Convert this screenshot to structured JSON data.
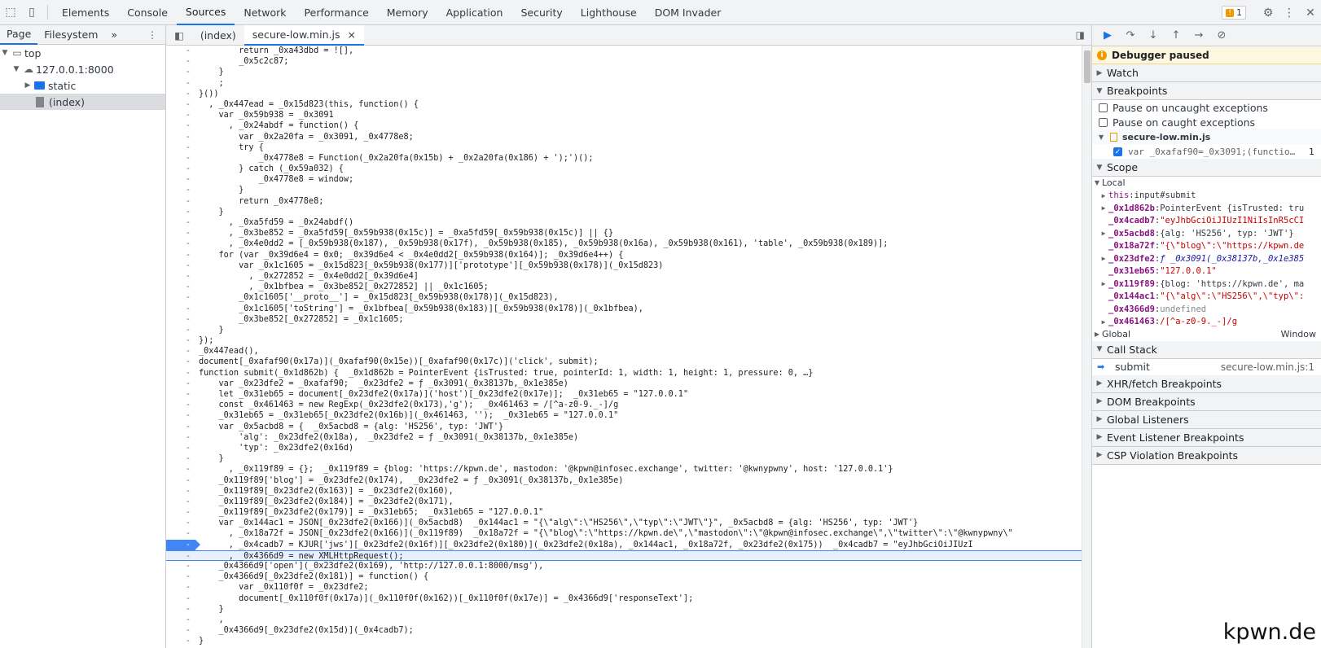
{
  "toolbar": {
    "tabs": [
      "Elements",
      "Console",
      "Sources",
      "Network",
      "Performance",
      "Memory",
      "Application",
      "Security",
      "Lighthouse",
      "DOM Invader"
    ],
    "active_tab": "Sources",
    "issues_count": "1"
  },
  "navigator": {
    "tabs": [
      "Page",
      "Filesystem"
    ],
    "more": "»",
    "tree": [
      {
        "label": "top",
        "depth": 0
      },
      {
        "label": "127.0.0.1:8000",
        "depth": 1
      },
      {
        "label": "static",
        "depth": 2
      },
      {
        "label": "(index)",
        "depth": 2
      }
    ]
  },
  "editor": {
    "tabs": [
      "(index)",
      "secure-low.min.js"
    ],
    "close_glyph": "×",
    "lines": [
      "        return _0xa43dbd = ![],",
      "        _0x5c2c87;",
      "    }",
      "    ;",
      "}())",
      "  , _0x447ead = _0x15d823(this, function() {",
      "    var _0x59b938 = _0x3091",
      "      , _0x24abdf = function() {",
      "        var _0x2a20fa = _0x3091, _0x4778e8;",
      "        try {",
      "            _0x4778e8 = Function(_0x2a20fa(0x15b) + _0x2a20fa(0x186) + ');')();",
      "        } catch (_0x59a032) {",
      "            _0x4778e8 = window;",
      "        }",
      "        return _0x4778e8;",
      "    }",
      "      , _0xa5fd59 = _0x24abdf()",
      "      , _0x3be852 = _0xa5fd59[_0x59b938(0x15c)] = _0xa5fd59[_0x59b938(0x15c)] || {}",
      "      , _0x4e0dd2 = [_0x59b938(0x187), _0x59b938(0x17f), _0x59b938(0x185), _0x59b938(0x16a), _0x59b938(0x161), 'table', _0x59b938(0x189)];",
      "    for (var _0x39d6e4 = 0x0; _0x39d6e4 < _0x4e0dd2[_0x59b938(0x164)]; _0x39d6e4++) {",
      "        var _0x1c1605 = _0x15d823[_0x59b938(0x177)]['prototype'][_0x59b938(0x178)](_0x15d823)",
      "          , _0x272852 = _0x4e0dd2[_0x39d6e4]",
      "          , _0x1bfbea = _0x3be852[_0x272852] || _0x1c1605;",
      "        _0x1c1605['__proto__'] = _0x15d823[_0x59b938(0x178)](_0x15d823),",
      "        _0x1c1605['toString'] = _0x1bfbea[_0x59b938(0x183)][_0x59b938(0x178)](_0x1bfbea),",
      "        _0x3be852[_0x272852] = _0x1c1605;",
      "    }",
      "});",
      "_0x447ead(),",
      "document[_0xafaf90(0x17a)](_0xafaf90(0x15e))[_0xafaf90(0x17c)]('click', submit);",
      "function submit(_0x1d862b) {  _0x1d862b = PointerEvent {isTrusted: true, pointerId: 1, width: 1, height: 1, pressure: 0, …}",
      "    var _0x23dfe2 = _0xafaf90;  _0x23dfe2 = ƒ _0x3091(_0x38137b,_0x1e385e)",
      "    let _0x31eb65 = document[_0x23dfe2(0x17a)]('host')[_0x23dfe2(0x17e)];  _0x31eb65 = \"127.0.0.1\"",
      "    const _0x461463 = new RegExp(_0x23dfe2(0x173),'g');  _0x461463 = /[^a-z0-9._-]/g",
      "    _0x31eb65 = _0x31eb65[_0x23dfe2(0x16b)](_0x461463, '');  _0x31eb65 = \"127.0.0.1\"",
      "    var _0x5acbd8 = {  _0x5acbd8 = {alg: 'HS256', typ: 'JWT'}",
      "        'alg': _0x23dfe2(0x18a),  _0x23dfe2 = ƒ _0x3091(_0x38137b,_0x1e385e)",
      "        'typ': _0x23dfe2(0x16d)",
      "    }",
      "      , _0x119f89 = {};  _0x119f89 = {blog: 'https://kpwn.de', mastodon: '@kpwn@infosec.exchange', twitter: '@kwnypwny', host: '127.0.0.1'}",
      "    _0x119f89['blog'] = _0x23dfe2(0x174),  _0x23dfe2 = ƒ _0x3091(_0x38137b,_0x1e385e)",
      "    _0x119f89[_0x23dfe2(0x163)] = _0x23dfe2(0x160),",
      "    _0x119f89[_0x23dfe2(0x184)] = _0x23dfe2(0x171),",
      "    _0x119f89[_0x23dfe2(0x179)] = _0x31eb65;  _0x31eb65 = \"127.0.0.1\"",
      "    var _0x144ac1 = JSON[_0x23dfe2(0x166)](_0x5acbd8)  _0x144ac1 = \"{\\\"alg\\\":\\\"HS256\\\",\\\"typ\\\":\\\"JWT\\\"}\", _0x5acbd8 = {alg: 'HS256', typ: 'JWT'}",
      "      , _0x18a72f = JSON[_0x23dfe2(0x166)](_0x119f89)  _0x18a72f = \"{\\\"blog\\\":\\\"https://kpwn.de\\\",\\\"mastodon\\\":\\\"@kpwn@infosec.exchange\\\",\\\"twitter\\\":\\\"@kwnypwny\\\"",
      "      , _0x4cadb7 = KJUR['jws'][_0x23dfe2(0x16f)][_0x23dfe2(0x180)](_0x23dfe2(0x18a), _0x144ac1, _0x18a72f, _0x23dfe2(0x175))  _0x4cadb7 = \"eyJhbGciOiJIUzI",
      "      , _0x4366d9 = new XMLHttpRequest();",
      "    _0x4366d9['open'](_0x23dfe2(0x169), 'http://127.0.0.1:8000/msg'),",
      "    _0x4366d9[_0x23dfe2(0x181)] = function() {",
      "        var _0x110f0f = _0x23dfe2;",
      "        document[_0x110f0f(0x17a)](_0x110f0f(0x162))[_0x110f0f(0x17e)] = _0x4366d9['responseText'];",
      "    }",
      "    ,",
      "    _0x4366d9[_0x23dfe2(0x15d)](_0x4cadb7);",
      "}"
    ],
    "gutter_mark": "-",
    "breakpoint_line_index": 46,
    "paused_line_index": 47
  },
  "debugger": {
    "paused_label": "Debugger paused",
    "watch": "Watch",
    "breakpoints": "Breakpoints",
    "pause_uncaught": "Pause on uncaught exceptions",
    "pause_caught": "Pause on caught exceptions",
    "bp_file": "secure-low.min.js",
    "bp_code": "var _0xafaf90=_0x3091;(functio…",
    "bp_line": "1",
    "scope": "Scope",
    "local": "Local",
    "scope_vars": [
      {
        "name": "this",
        "value": "input#submit",
        "kind": "obj",
        "expandable": true,
        "plain": true
      },
      {
        "name": "_0x1d862b",
        "value": "PointerEvent {isTrusted: tru",
        "kind": "obj",
        "expandable": true
      },
      {
        "name": "_0x4cadb7",
        "value": "\"eyJhbGciOiJIUzI1NiIsInR5cCI",
        "kind": "str",
        "expandable": false
      },
      {
        "name": "_0x5acbd8",
        "value": "{alg: 'HS256', typ: 'JWT'}",
        "kind": "obj",
        "expandable": true
      },
      {
        "name": "_0x18a72f",
        "value": "\"{\\\"blog\\\":\\\"https://kpwn.de",
        "kind": "str",
        "expandable": false
      },
      {
        "name": "_0x23dfe2",
        "value": "ƒ _0x3091(_0x38137b,_0x1e385",
        "kind": "fn",
        "expandable": true
      },
      {
        "name": "_0x31eb65",
        "value": "\"127.0.0.1\"",
        "kind": "str",
        "expandable": false
      },
      {
        "name": "_0x119f89",
        "value": "{blog: 'https://kpwn.de', ma",
        "kind": "obj",
        "expandable": true
      },
      {
        "name": "_0x144ac1",
        "value": "\"{\\\"alg\\\":\\\"HS256\\\",\\\"typ\\\":",
        "kind": "str",
        "expandable": false
      },
      {
        "name": "_0x4366d9",
        "value": "undefined",
        "kind": "undef",
        "expandable": false
      },
      {
        "name": "_0x461463",
        "value": "/[^a-z0-9._-]/g",
        "kind": "str",
        "expandable": true
      }
    ],
    "global": "Global",
    "global_value": "Window",
    "call_stack": "Call Stack",
    "call_stack_frame": "submit",
    "call_stack_location": "secure-low.min.js:1",
    "collapsed_sections": [
      "XHR/fetch Breakpoints",
      "DOM Breakpoints",
      "Global Listeners",
      "Event Listener Breakpoints",
      "CSP Violation Breakpoints"
    ]
  },
  "watermark": "kpwn.de"
}
